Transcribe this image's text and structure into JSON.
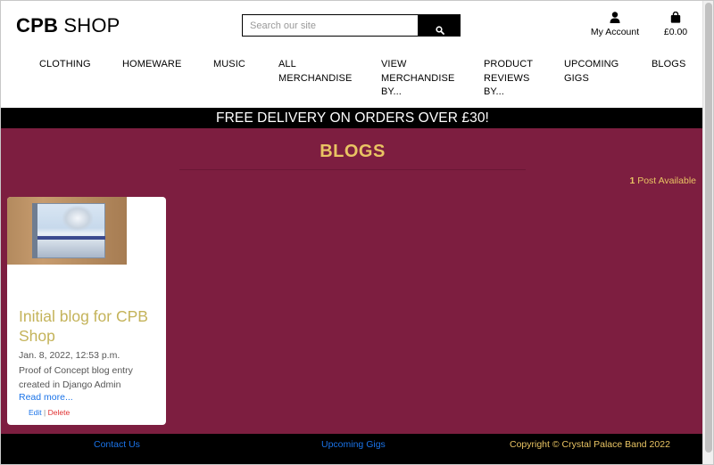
{
  "header": {
    "logo_bold": "CPB",
    "logo_light": "SHOP",
    "search_placeholder": "Search our site",
    "account_label": "My Account",
    "cart_total": "£0.00"
  },
  "nav": {
    "items": [
      {
        "label": "CLOTHING"
      },
      {
        "label": "HOMEWARE"
      },
      {
        "label": "MUSIC"
      },
      {
        "label": "ALL MERCHANDISE"
      },
      {
        "label": "VIEW MERCHANDISE BY..."
      },
      {
        "label": "PRODUCT REVIEWS BY..."
      },
      {
        "label": "UPCOMING GIGS"
      },
      {
        "label": "BLOGS"
      }
    ]
  },
  "banner": {
    "text": "FREE DELIVERY ON ORDERS OVER £30!"
  },
  "main": {
    "title": "BLOGS",
    "post_count": "1",
    "post_count_label": "Post Available",
    "posts": [
      {
        "title": "Initial blog for CPB Shop",
        "date": "Jan. 8, 2022, 12:53 p.m.",
        "excerpt": "Proof of Concept blog entry created in Django Admin",
        "read_more": "Read more...",
        "edit_label": "Edit",
        "separator": "|",
        "delete_label": "Delete"
      }
    ]
  },
  "footer": {
    "contact": "Contact Us",
    "gigs": "Upcoming Gigs",
    "copyright": "Copyright © Crystal Palace Band 2022"
  },
  "colors": {
    "accent_gold": "#e9c463",
    "maroon": "#7d1e40",
    "link_blue": "#1a73e8",
    "delete_red": "#e03030"
  },
  "icons": {
    "search": "search-icon",
    "account": "user-icon",
    "cart": "shopping-bag-icon"
  }
}
